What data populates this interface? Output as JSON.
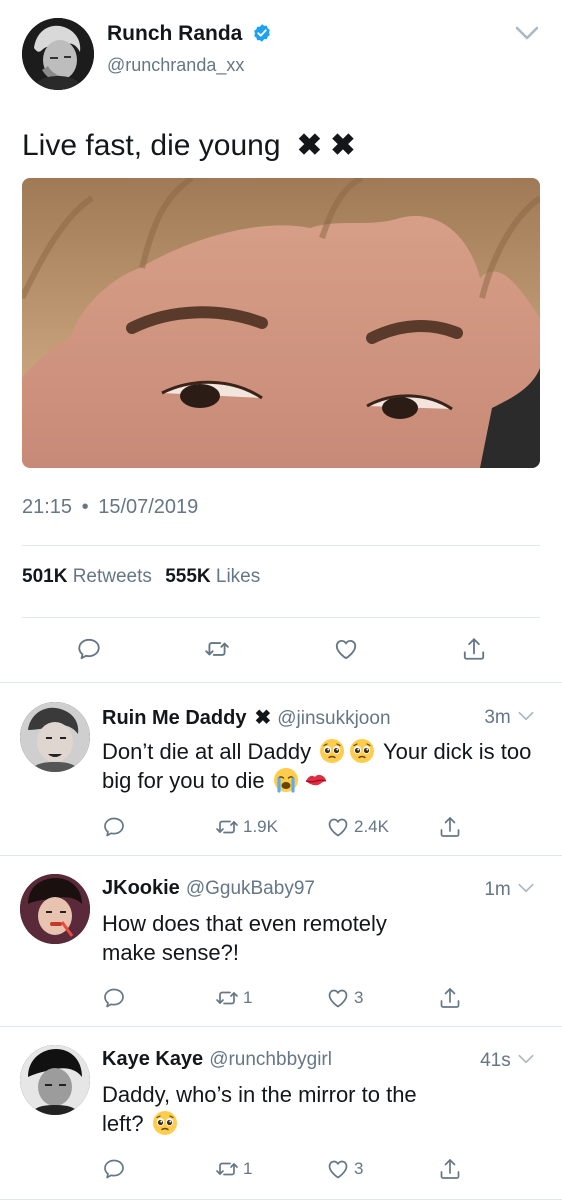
{
  "main_tweet": {
    "display_name": "Runch Randa",
    "handle": "@runchranda_xx",
    "text": "Live fast, die young",
    "text_marks": "✖ ✖",
    "time": "21:15",
    "separator": "•",
    "date": "15/07/2019",
    "retweets_count": "501K",
    "retweets_label": "Retweets",
    "likes_count": "555K",
    "likes_label": "Likes",
    "icons": {
      "reply": "reply-icon",
      "retweet": "retweet-icon",
      "like": "heart-icon",
      "share": "share-icon",
      "verified": "verified-badge-icon",
      "more": "chevron-down-icon"
    }
  },
  "replies": [
    {
      "display_name": "Ruin Me Daddy",
      "name_mark": "✖",
      "handle": "@jinsukkjoon",
      "time": "3m",
      "text_part1": "Don’t die at all Daddy",
      "text_part2": "Your",
      "text_part3": "dick is too big for you to die",
      "emojis": [
        "pleading-face-emoji",
        "pleading-face-emoji",
        "crying-face-emoji",
        "kiss-mark-emoji"
      ],
      "retweets": "1.9K",
      "likes": "2.4K"
    },
    {
      "display_name": "JKookie",
      "handle": "@GgukBaby97",
      "time": "1m",
      "text": "How does that even remotely make sense?!",
      "retweets": "1",
      "likes": "3"
    },
    {
      "display_name": "Kaye Kaye",
      "handle": "@runchbbygirl",
      "time": "41s",
      "text": "Daddy, who’s in the mirror to the left?",
      "emojis": [
        "pleading-face-emoji"
      ],
      "retweets": "1",
      "likes": "3"
    }
  ],
  "colors": {
    "text": "#14171a",
    "secondary": "#657786",
    "divider": "#e1e8ed",
    "verified": "#1da1f2",
    "heart_red": "#e0245e"
  }
}
